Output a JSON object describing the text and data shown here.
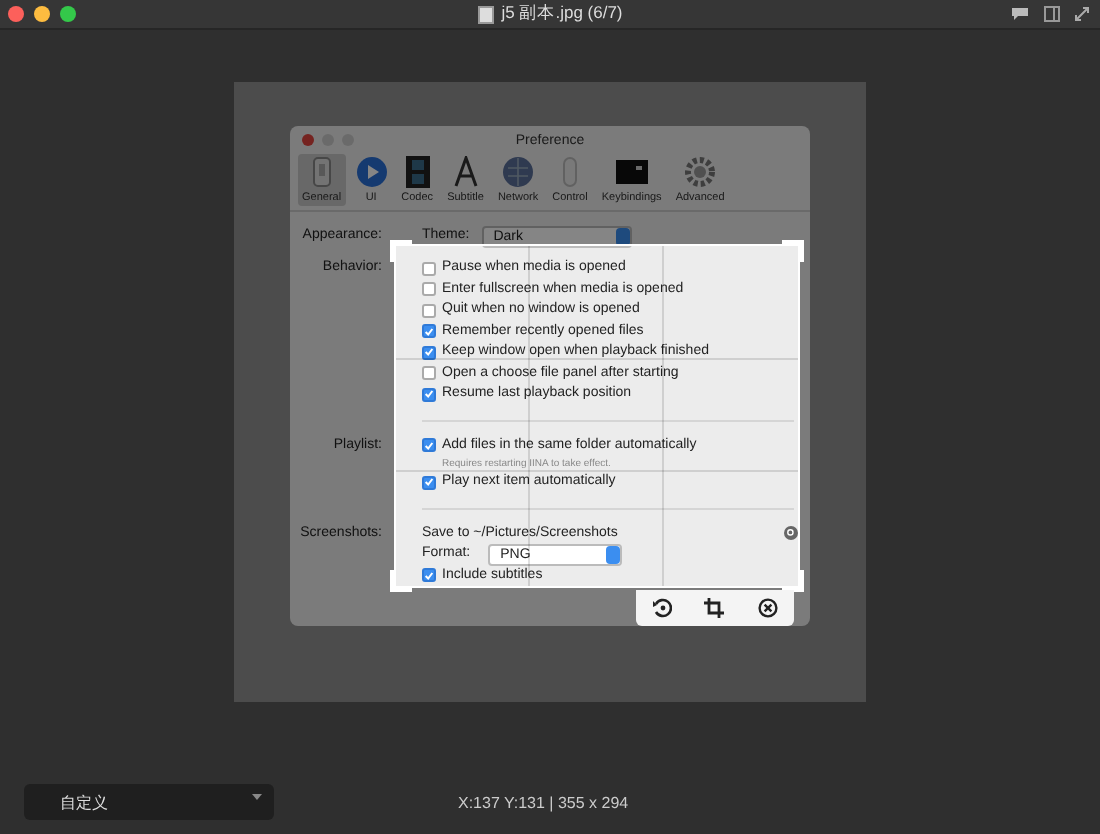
{
  "window": {
    "title": "j5 副本.jpg (6/7)"
  },
  "preference": {
    "title": "Preference",
    "tabs": [
      {
        "label": "General",
        "kind": "general",
        "selected": true
      },
      {
        "label": "UI",
        "kind": "ui",
        "selected": false
      },
      {
        "label": "Codec",
        "kind": "codec",
        "selected": false
      },
      {
        "label": "Subtitle",
        "kind": "subtitle",
        "selected": false
      },
      {
        "label": "Network",
        "kind": "network",
        "selected": false
      },
      {
        "label": "Control",
        "kind": "control",
        "selected": false
      },
      {
        "label": "Keybindings",
        "kind": "keybindings",
        "selected": false
      },
      {
        "label": "Advanced",
        "kind": "advanced",
        "selected": false
      }
    ],
    "appearance": {
      "label": "Appearance:",
      "theme_label": "Theme:",
      "theme_value": "Dark"
    },
    "sections": [
      {
        "label": "Behavior:",
        "items": [
          {
            "kind": "checkbox",
            "text": "Pause when media is opened",
            "checked": false
          },
          {
            "kind": "checkbox",
            "text": "Enter fullscreen when media is opened",
            "checked": false
          },
          {
            "kind": "checkbox",
            "text": "Quit when no window is opened",
            "checked": false
          },
          {
            "kind": "checkbox",
            "text": "Remember recently opened files",
            "checked": true
          },
          {
            "kind": "checkbox",
            "text": "Keep window open when playback finished",
            "checked": true
          },
          {
            "kind": "checkbox",
            "text": "Open a choose file panel after starting",
            "checked": false
          },
          {
            "kind": "checkbox",
            "text": "Resume last playback position",
            "checked": true
          }
        ]
      },
      {
        "label": "Playlist:",
        "items": [
          {
            "kind": "checkbox",
            "text": "Add files in the same folder automatically",
            "checked": true
          },
          {
            "kind": "note",
            "text": "Requires restarting IINA to take effect."
          },
          {
            "kind": "checkbox",
            "text": "Play next item automatically",
            "checked": true
          }
        ]
      }
    ],
    "screenshots": {
      "label": "Screenshots:",
      "save_to": "Save to ~/Pictures/Screenshots",
      "format_label": "Format:",
      "format_value": "PNG",
      "include_subtitles": {
        "text": "Include subtitles",
        "checked": true
      }
    }
  },
  "bottom_bar": {
    "preset": "自定义",
    "info": "X:137 Y:131 | 355 x 294"
  }
}
